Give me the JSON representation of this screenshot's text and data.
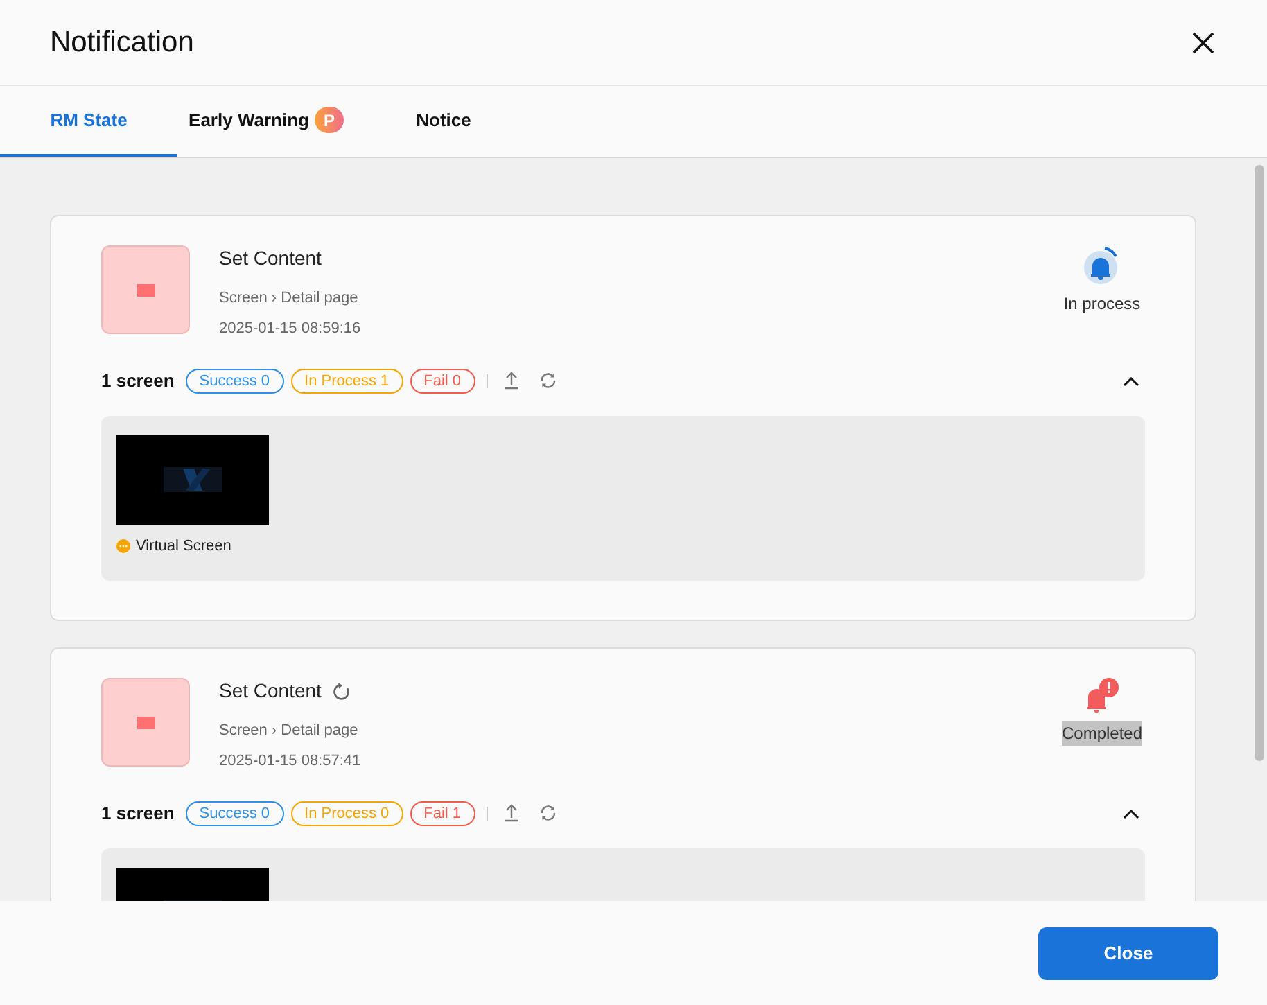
{
  "dialog": {
    "title": "Notification"
  },
  "tabs": [
    {
      "label": "RM State",
      "selected": true
    },
    {
      "label": "Early Warning",
      "selected": false,
      "badge": "P"
    },
    {
      "label": "Notice",
      "selected": false
    }
  ],
  "cards": [
    {
      "title": "Set Content",
      "retry": false,
      "path": "Screen › Detail page",
      "time": "2025-01-15 08:59:16",
      "status": {
        "kind": "in_process",
        "label": "In process",
        "highlighted": false
      },
      "count": "1 screen",
      "chips": [
        {
          "kind": "success",
          "label": "Success 0"
        },
        {
          "kind": "process",
          "label": "In Process 1"
        },
        {
          "kind": "fail",
          "label": "Fail 0"
        }
      ],
      "screens": [
        {
          "kind": "picture",
          "name": "Virtual Screen",
          "color": "#f5a500"
        }
      ]
    },
    {
      "title": "Set Content",
      "retry": true,
      "path": "Screen › Detail page",
      "time": "2025-01-15 08:57:41",
      "status": {
        "kind": "completed",
        "label": "Completed",
        "highlighted": true
      },
      "count": "1 screen",
      "chips": [
        {
          "kind": "success",
          "label": "Success 0"
        },
        {
          "kind": "process",
          "label": "In Process 0"
        },
        {
          "kind": "fail",
          "label": "Fail 1"
        }
      ]
    }
  ],
  "footer": {
    "close_button": "Close"
  }
}
